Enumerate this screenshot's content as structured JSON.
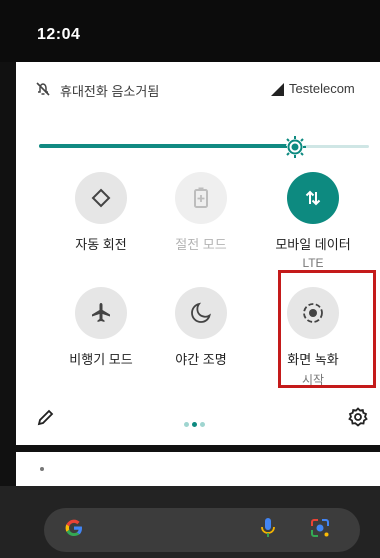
{
  "status_bar": {
    "time": "12:04"
  },
  "header": {
    "mute_text": "휴대전화 음소거됨",
    "carrier": "Testelecom"
  },
  "brightness": {
    "level": 0.79
  },
  "tiles": [
    {
      "label": "자동 회전",
      "sub": "",
      "icon": "auto-rotate-icon",
      "state": "off"
    },
    {
      "label": "절전 모드",
      "sub": "",
      "icon": "battery-saver-icon",
      "state": "disabled"
    },
    {
      "label": "모바일 데이터",
      "sub": "LTE",
      "icon": "mobile-data-icon",
      "state": "on"
    },
    {
      "label": "비행기 모드",
      "sub": "",
      "icon": "airplane-icon",
      "state": "off"
    },
    {
      "label": "야간 조명",
      "sub": "",
      "icon": "night-light-icon",
      "state": "off"
    },
    {
      "label": "화면 녹화",
      "sub": "시작",
      "icon": "screen-record-icon",
      "state": "off"
    }
  ],
  "pagination": {
    "pages": 3,
    "current": 2
  },
  "colors": {
    "accent": "#0d8a80",
    "highlight": "#c41a1a"
  }
}
